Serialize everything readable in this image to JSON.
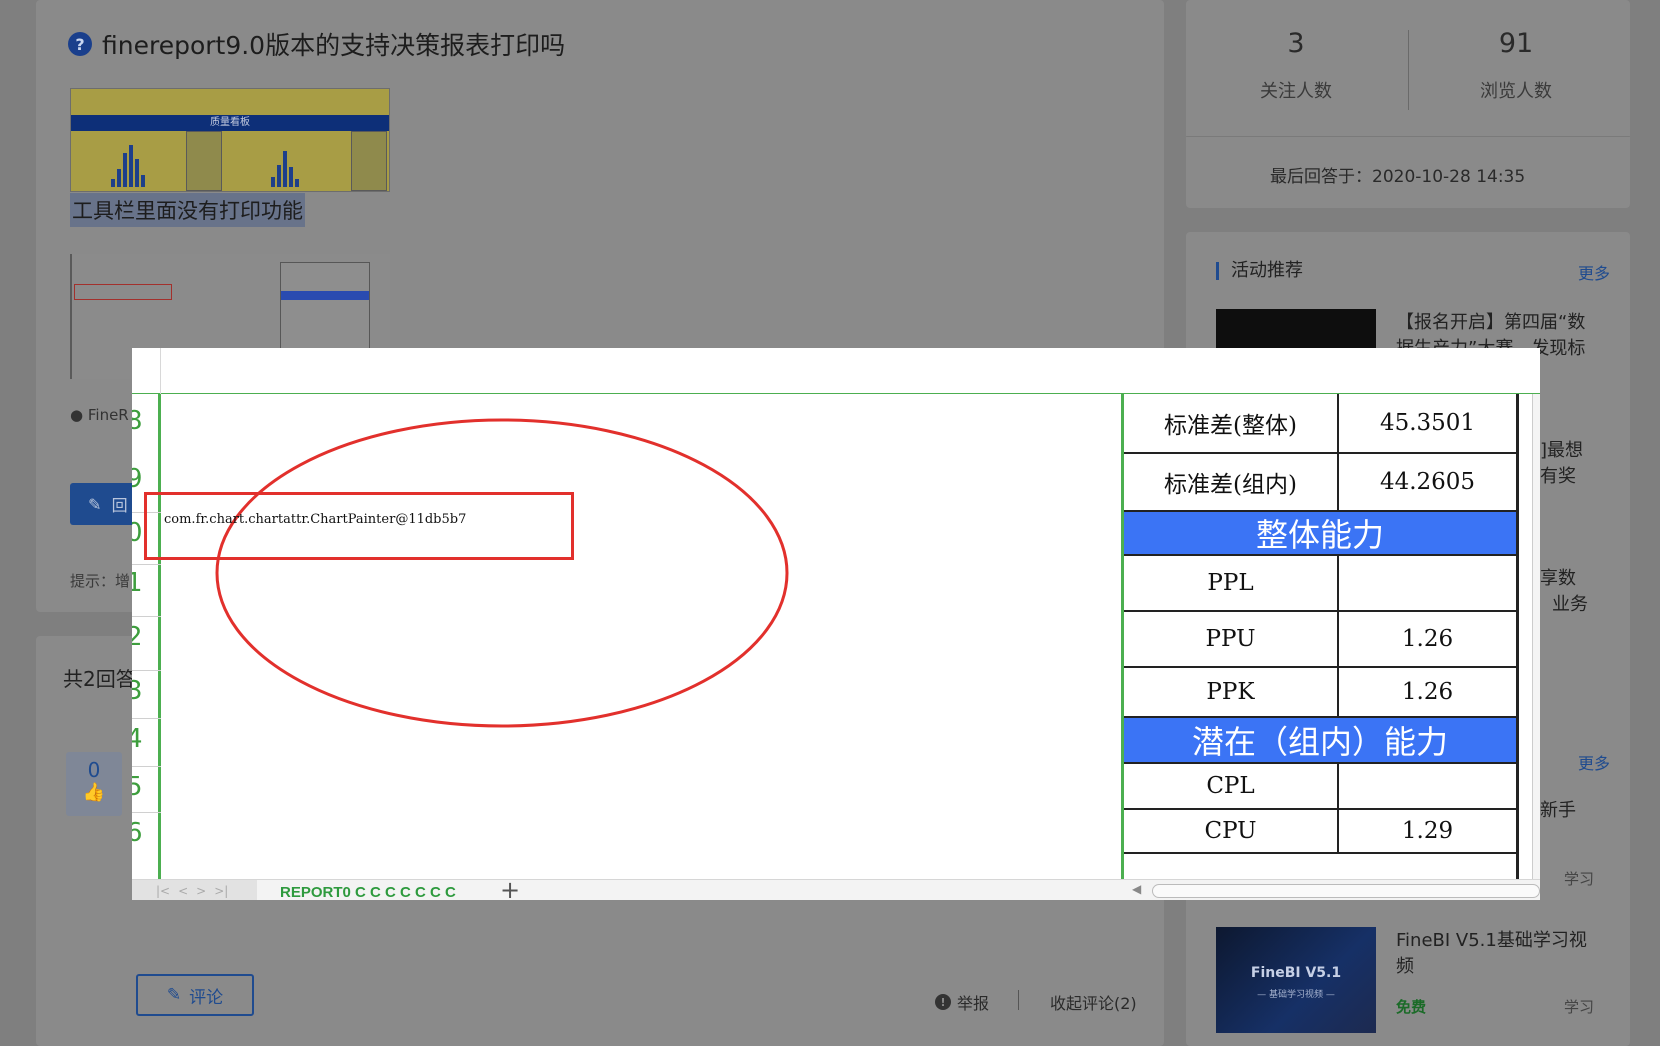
{
  "question": {
    "title": "finereport9.0版本的支持决策报表打印吗",
    "icon": "question-icon",
    "thumb1_header": "质量看板",
    "caption1": "工具栏里面没有打印功能",
    "tag": "FineR",
    "answer_button": "回",
    "hint": "提示：增",
    "answers_count": "共2回答"
  },
  "answer": {
    "votes": "0",
    "comment_label": "评论",
    "report_label": "举报",
    "collapse_label": "收起评论(2)"
  },
  "sidebar": {
    "stats": [
      {
        "value": "3",
        "label": "关注人数"
      },
      {
        "value": "91",
        "label": "浏览人数"
      }
    ],
    "last_answer_label": "最后回答于：",
    "last_answer_time": "2020-10-28 14:35",
    "activity_title": "活动推荐",
    "more_label": "更多",
    "activity_text": "【报名开启】第四届“数据生产力”大赛，发现标",
    "fragments": [
      "]最想",
      "有奖",
      "享数",
      "业务",
      "新手",
      "学习"
    ],
    "course_title": "FineBI V5.1基础学习视频",
    "course_img_title": "FineBI V5.1",
    "course_img_sub": "— 基础学习视频 —",
    "course_free": "免费",
    "course_learn": "学习"
  },
  "overlay": {
    "row_numbers": [
      "8",
      "9",
      "0",
      "1",
      "2",
      "3",
      "4",
      "5",
      "6"
    ],
    "code_text": "com.fr.chart.chartattr.ChartPainter@11db5b7",
    "table": [
      {
        "label": "标准差(整体)",
        "value": "45.3501"
      },
      {
        "label": "标准差(组内)",
        "value": "44.2605"
      },
      {
        "band": "整体能力"
      },
      {
        "label": "PPL",
        "value": ""
      },
      {
        "label": "PPU",
        "value": "1.26"
      },
      {
        "label": "PPK",
        "value": "1.26"
      },
      {
        "band": "潜在（组内）能力"
      },
      {
        "label": "CPL",
        "value": ""
      },
      {
        "label": "CPU",
        "value": "1.29"
      }
    ],
    "sheet_tab": "REPORT0",
    "sheet_tab_suffix": "C C C C C C C",
    "add_sheet": "+"
  },
  "colors": {
    "accent_blue": "#3b74f5",
    "grid_green": "#4caf50",
    "annotation_red": "#e2302c"
  }
}
